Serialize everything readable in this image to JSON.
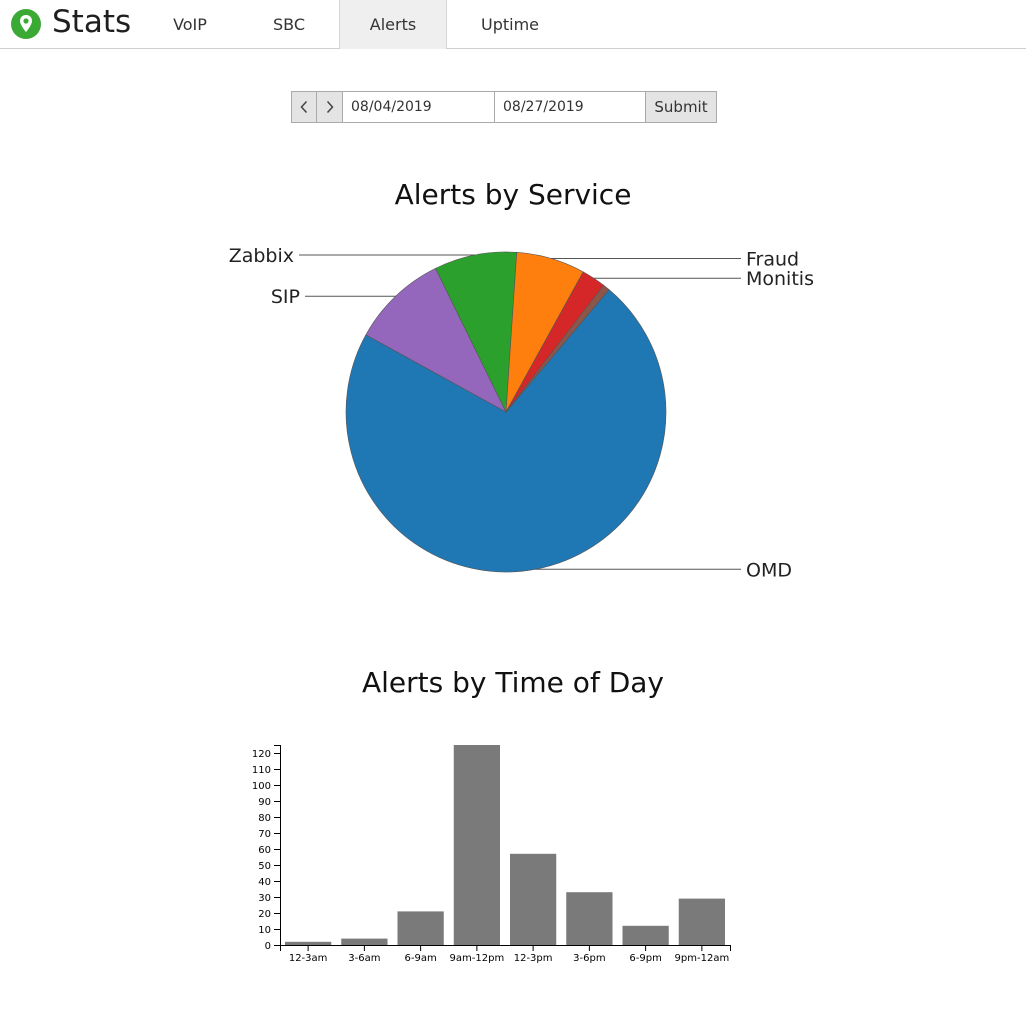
{
  "header": {
    "brand": "Stats",
    "tabs": [
      {
        "label": "VoIP"
      },
      {
        "label": "SBC"
      },
      {
        "label": "Alerts",
        "active": true
      },
      {
        "label": "Uptime"
      }
    ],
    "logo_color": "#3aaa35"
  },
  "date_range": {
    "start": "08/04/2019",
    "end": "08/27/2019",
    "submit_label": "Submit"
  },
  "charts": {
    "pie_title": "Alerts by Service",
    "bar_title": "Alerts by Time of Day"
  },
  "chart_data": [
    {
      "type": "pie",
      "title": "Alerts by Service",
      "slices": [
        {
          "label": "OMD",
          "value": 207,
          "color": "#1f77b4"
        },
        {
          "label": "SIP",
          "value": 28,
          "color": "#9467bd"
        },
        {
          "label": "Zabbix",
          "value": 24,
          "color": "#2ca02c"
        },
        {
          "label": "Fraud",
          "value": 20,
          "color": "#ff7f0e"
        },
        {
          "label": "Monitis",
          "value": 7,
          "color": "#d62728"
        },
        {
          "label": "",
          "value": 2,
          "color": "#8c564b"
        }
      ]
    },
    {
      "type": "bar",
      "title": "Alerts by Time of Day",
      "categories": [
        "12-3am",
        "3-6am",
        "6-9am",
        "9am-12pm",
        "12-3pm",
        "3-6pm",
        "6-9pm",
        "9pm-12am"
      ],
      "values": [
        2,
        4,
        21,
        125,
        57,
        33,
        12,
        29
      ],
      "ylim": [
        0,
        125
      ],
      "yticks": [
        0,
        10,
        20,
        30,
        40,
        50,
        60,
        70,
        80,
        90,
        100,
        110,
        120
      ],
      "bar_color": "#7a7a7a"
    }
  ]
}
